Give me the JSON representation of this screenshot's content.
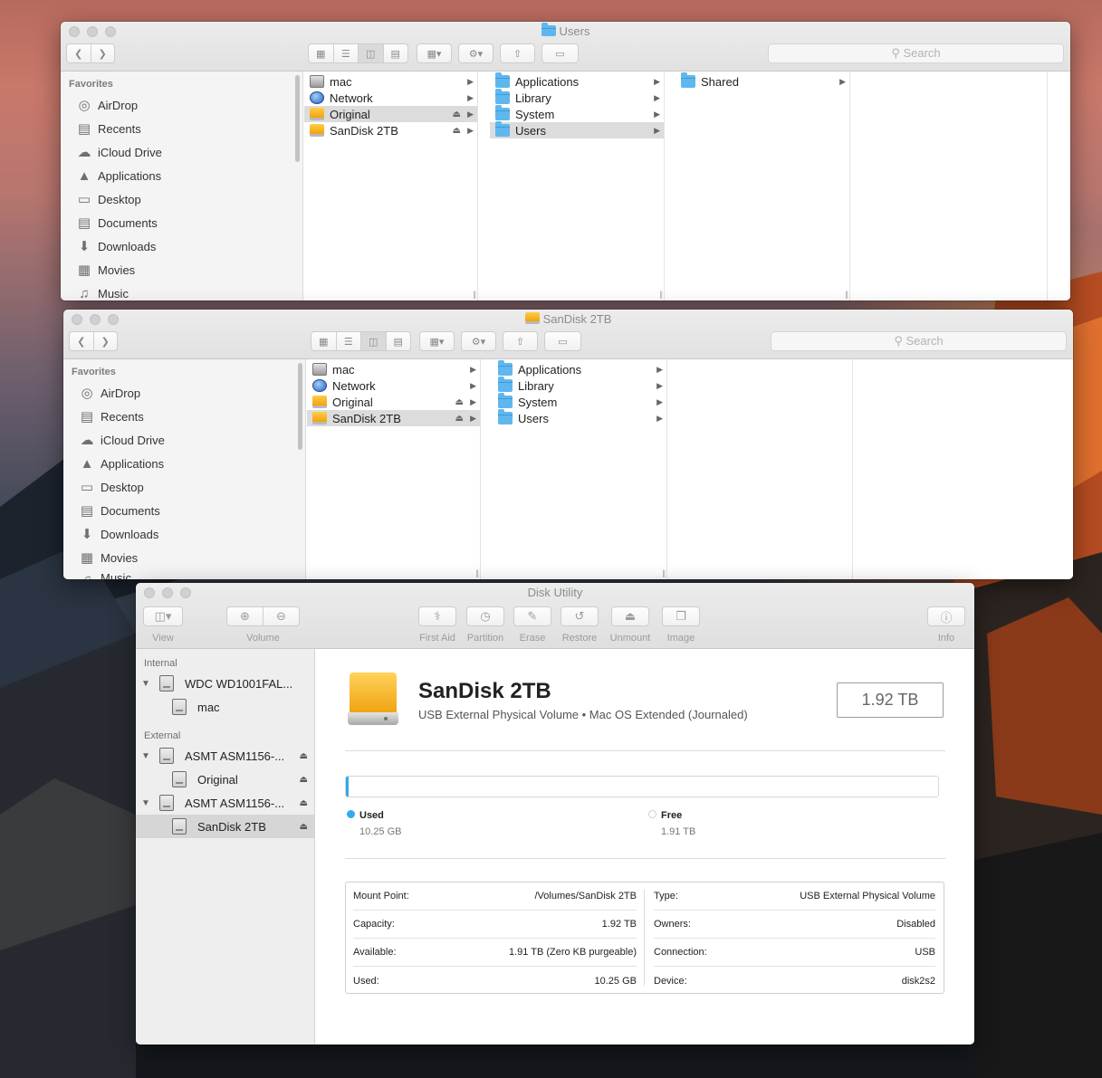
{
  "finder1": {
    "title": "Users",
    "search_placeholder": "Search",
    "sidebar": {
      "header": "Favorites",
      "items": [
        {
          "label": "AirDrop",
          "icon": "airdrop-icon"
        },
        {
          "label": "Recents",
          "icon": "recents-icon"
        },
        {
          "label": "iCloud Drive",
          "icon": "cloud-icon"
        },
        {
          "label": "Applications",
          "icon": "applications-icon"
        },
        {
          "label": "Desktop",
          "icon": "desktop-icon"
        },
        {
          "label": "Documents",
          "icon": "documents-icon"
        },
        {
          "label": "Downloads",
          "icon": "downloads-icon"
        },
        {
          "label": "Movies",
          "icon": "movies-icon"
        },
        {
          "label": "Music",
          "icon": "music-icon"
        }
      ]
    },
    "col1": [
      "mac",
      "Network",
      "Original",
      "SanDisk 2TB"
    ],
    "col2": [
      "Applications",
      "Library",
      "System",
      "Users"
    ],
    "col3": [
      "Shared"
    ]
  },
  "finder2": {
    "title": "SanDisk 2TB",
    "search_placeholder": "Search",
    "sidebar": {
      "header": "Favorites",
      "items": [
        {
          "label": "AirDrop"
        },
        {
          "label": "Recents"
        },
        {
          "label": "iCloud Drive"
        },
        {
          "label": "Applications"
        },
        {
          "label": "Desktop"
        },
        {
          "label": "Documents"
        },
        {
          "label": "Downloads"
        },
        {
          "label": "Movies"
        },
        {
          "label": "Music"
        }
      ]
    },
    "col1": [
      "mac",
      "Network",
      "Original",
      "SanDisk 2TB"
    ],
    "col2": [
      "Applications",
      "Library",
      "System",
      "Users"
    ]
  },
  "disk_utility": {
    "title": "Disk Utility",
    "toolbar": {
      "view": "View",
      "volume": "Volume",
      "first_aid": "First Aid",
      "partition": "Partition",
      "erase": "Erase",
      "restore": "Restore",
      "unmount": "Unmount",
      "image": "Image",
      "info": "Info"
    },
    "sidebar": {
      "internal_header": "Internal",
      "external_header": "External",
      "internal_disk": "WDC WD1001FAL...",
      "internal_volume": "mac",
      "ext_disk1": "ASMT ASM1156-...",
      "ext_volume1": "Original",
      "ext_disk2": "ASMT ASM1156-...",
      "ext_volume2": "SanDisk 2TB"
    },
    "volume": {
      "name": "SanDisk 2TB",
      "subtitle": "USB External Physical Volume • Mac OS Extended (Journaled)",
      "size": "1.92 TB",
      "used_fraction": 0.005,
      "used_label": "Used",
      "used_value": "10.25 GB",
      "free_label": "Free",
      "free_value": "1.91 TB",
      "used_color": "#35a9e9"
    },
    "info": {
      "left": [
        {
          "k": "Mount Point:",
          "v": "/Volumes/SanDisk 2TB"
        },
        {
          "k": "Capacity:",
          "v": "1.92 TB"
        },
        {
          "k": "Available:",
          "v": "1.91 TB (Zero KB purgeable)"
        },
        {
          "k": "Used:",
          "v": "10.25 GB"
        }
      ],
      "right": [
        {
          "k": "Type:",
          "v": "USB External Physical Volume"
        },
        {
          "k": "Owners:",
          "v": "Disabled"
        },
        {
          "k": "Connection:",
          "v": "USB"
        },
        {
          "k": "Device:",
          "v": "disk2s2"
        }
      ]
    }
  }
}
